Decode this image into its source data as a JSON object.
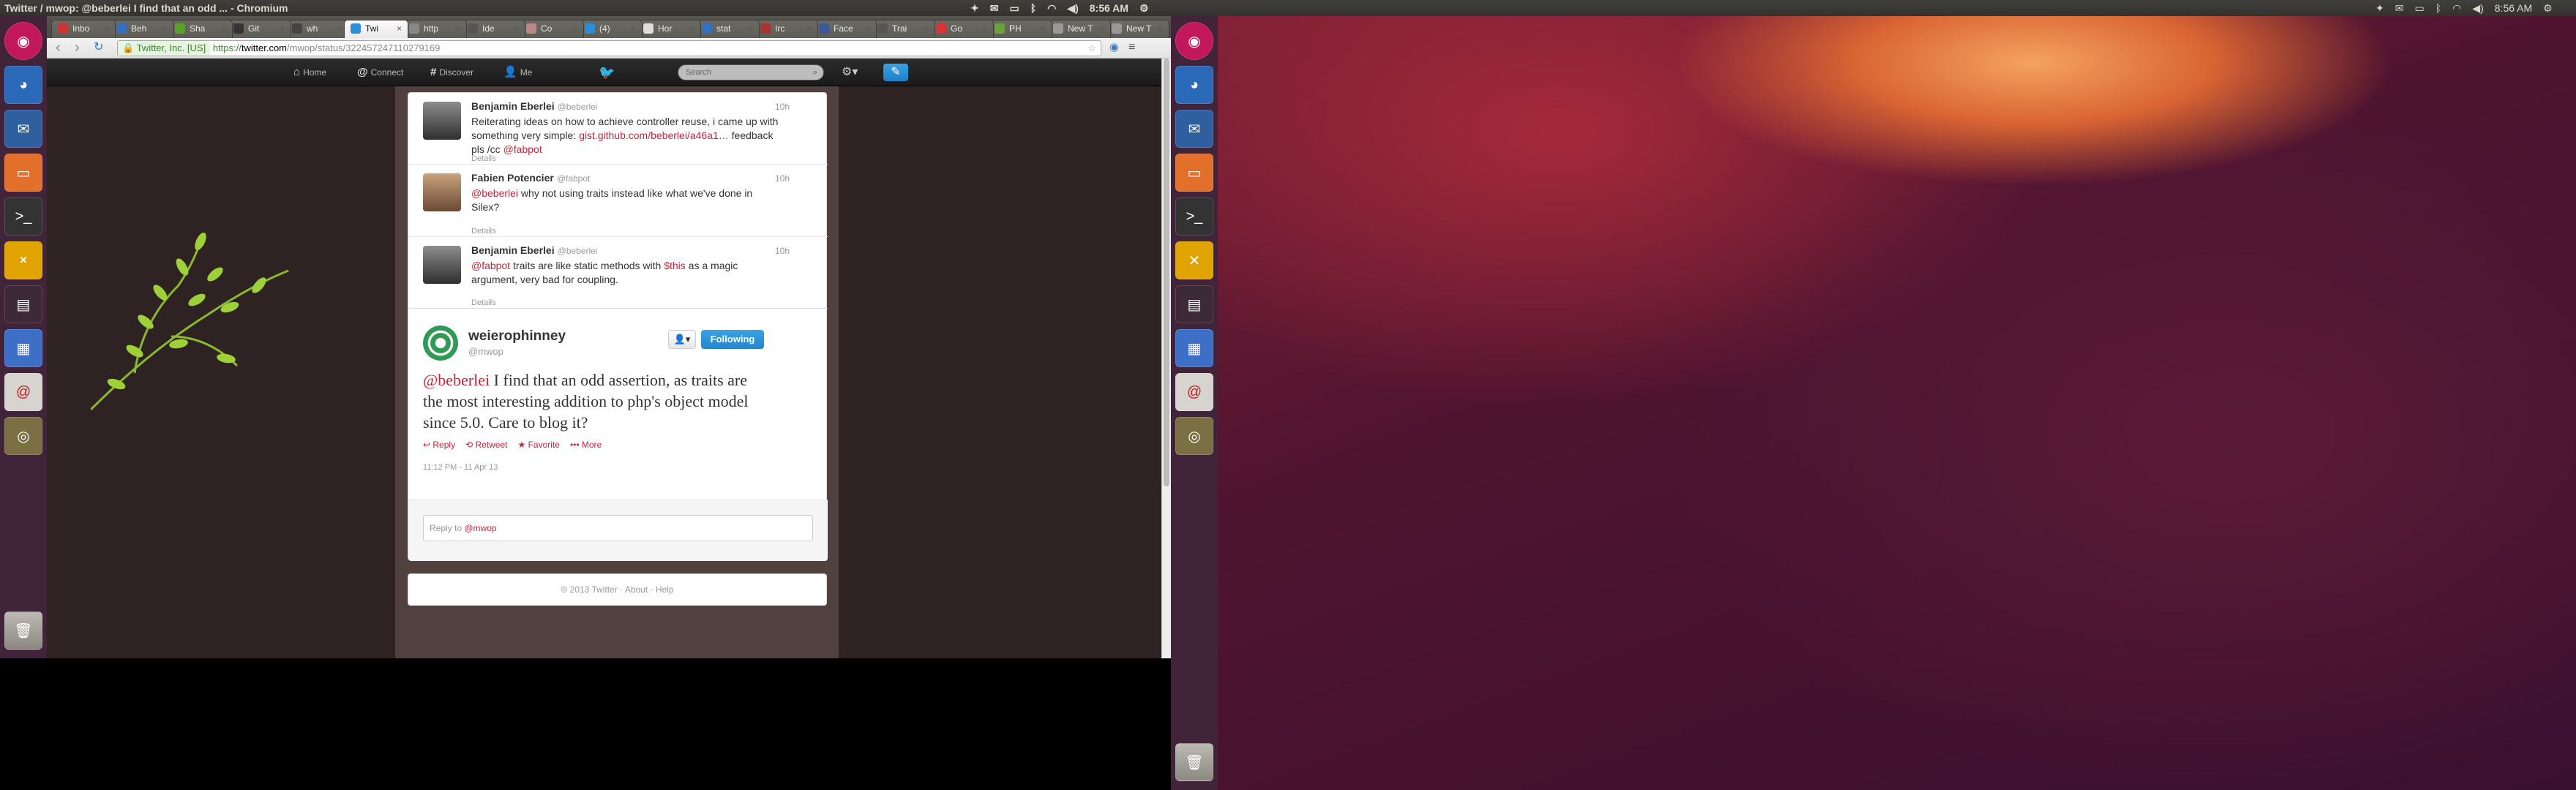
{
  "window_title": "Twitter / mwop: @beberlei I find that an odd ... - Chromium",
  "clock": "8:56 AM",
  "tabs": [
    "Inbo",
    "Beh",
    "Sha",
    "Git",
    "wh",
    "Twi",
    "http",
    "Ide",
    "Co",
    "(4)",
    "Hor",
    "stat",
    "Irc",
    "Face",
    "Trai",
    "Go",
    "PH",
    "New T",
    "New T"
  ],
  "omnibox": {
    "ev_name": "Twitter, Inc. [US]",
    "scheme": "https://",
    "host": "twitter.com",
    "path": "/mwop/status/322457247110279169"
  },
  "twitter_nav": {
    "home": "Home",
    "connect": "Connect",
    "discover": "Discover",
    "me": "Me",
    "search_placeholder": "Search"
  },
  "tweets": [
    {
      "name": "Benjamin Eberlei",
      "handle": "@beberlei",
      "time": "10h",
      "text_a": "Reiterating ideas on how to achieve controller reuse, i came up with something very simple: ",
      "link1": "gist.github.com/beberlei/a46a1…",
      "text_b": " feedback pls /cc ",
      "link2": "@fabpot",
      "details": "Details"
    },
    {
      "name": "Fabien Potencier",
      "handle": "@fabpot",
      "time": "10h",
      "link1": "@beberlei",
      "text_a": " why not using traits instead like what we've done in Silex?",
      "details": "Details"
    },
    {
      "name": "Benjamin Eberlei",
      "handle": "@beberlei",
      "time": "10h",
      "link1": "@fabpot",
      "text_a": " traits are like static methods with ",
      "link2": "$this",
      "text_b": " as a magic argument, very bad for coupling.",
      "details": "Details"
    }
  ],
  "main_tweet": {
    "name": "weierophinney",
    "handle": "@mwop",
    "follow_label": "Following",
    "mention": "@beberlei",
    "text": " I find that an odd assertion, as traits are the most interesting addition to php's object model since 5.0. Care to blog it?",
    "actions": {
      "reply": "Reply",
      "retweet": "Retweet",
      "favorite": "Favorite",
      "more": "More"
    },
    "timestamp": "11:12 PM - 11 Apr 13"
  },
  "reply_box": {
    "prefix": "Reply to ",
    "handle": "@mwop"
  },
  "footer": "© 2013 Twitter · About · Help",
  "colors": {
    "link": "#c6243c",
    "twitter_blue": "#2b8ed6"
  }
}
